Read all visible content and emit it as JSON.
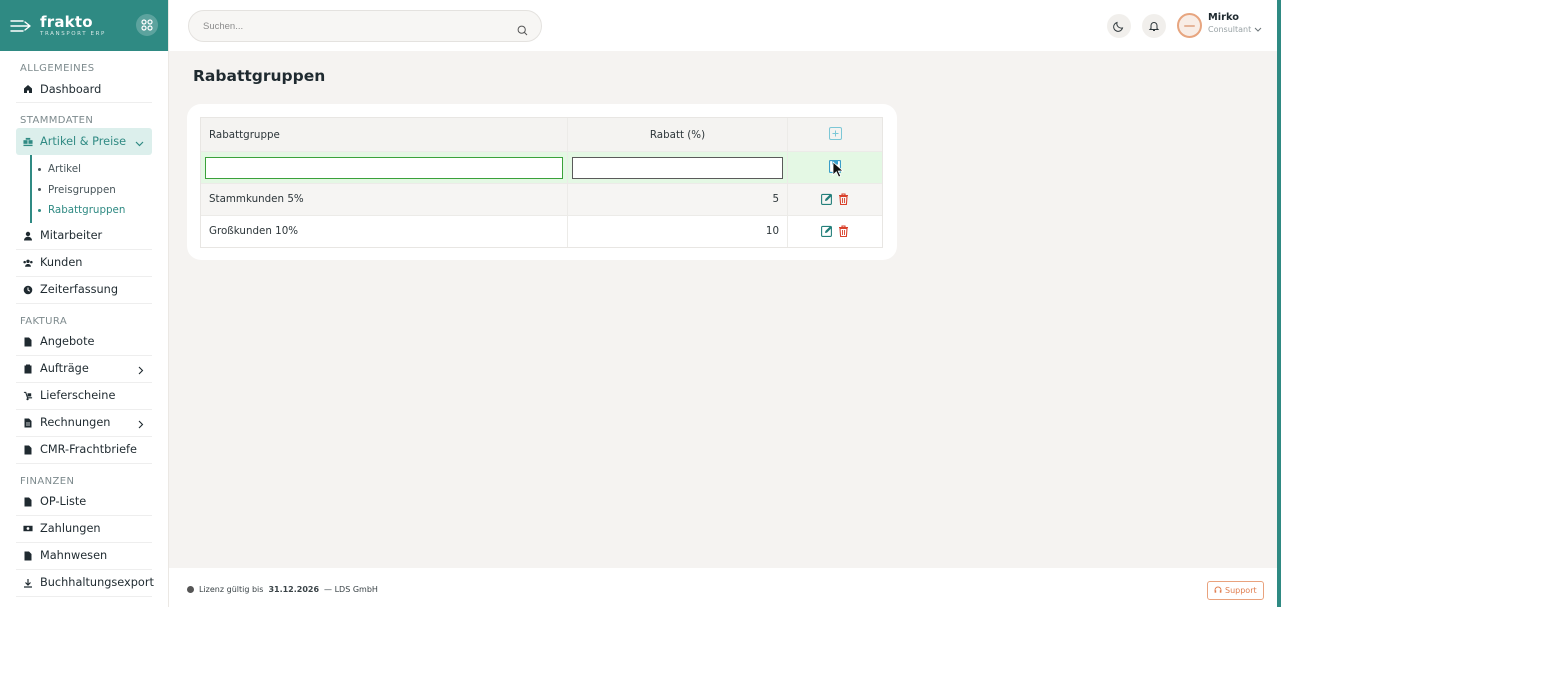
{
  "brand": {
    "name": "frakto",
    "subtitle": "TRANSPORT ERP"
  },
  "search": {
    "placeholder": "Suchen..."
  },
  "user": {
    "name": "Mirko",
    "role": "Consultant"
  },
  "sidebar": {
    "sections": [
      {
        "title": "ALLGEMEINES"
      },
      {
        "title": "STAMMDATEN"
      },
      {
        "title": "FAKTURA"
      },
      {
        "title": "FINANZEN"
      }
    ],
    "items": {
      "dashboard": "Dashboard",
      "artikel_preise": "Artikel & Preise",
      "mitarbeiter": "Mitarbeiter",
      "kunden": "Kunden",
      "zeiterfassung": "Zeiterfassung",
      "angebote": "Angebote",
      "auftraege": "Aufträge",
      "lieferscheine": "Lieferscheine",
      "rechnungen": "Rechnungen",
      "cmr": "CMR-Frachtbriefe",
      "op_liste": "OP-Liste",
      "zahlungen": "Zahlungen",
      "mahnwesen": "Mahnwesen",
      "buchhaltungsexport": "Buchhaltungsexport"
    },
    "sub_items": [
      "Artikel",
      "Preisgruppen",
      "Rabattgruppen"
    ]
  },
  "page": {
    "title": "Rabattgruppen"
  },
  "table": {
    "columns": [
      "Rabattgruppe",
      "Rabatt (%)"
    ],
    "new_row": {
      "name": "",
      "discount": ""
    },
    "rows": [
      {
        "name": "Stammkunden 5%",
        "discount": "5"
      },
      {
        "name": "Großkunden 10%",
        "discount": "10"
      }
    ]
  },
  "footer": {
    "license_prefix": "Lizenz gültig bis",
    "license_date": "31.12.2026",
    "company": "— LDS GmbH",
    "support_label": "Support"
  },
  "colors": {
    "brand": "#2f8a83",
    "danger": "#d9412b",
    "support": "#e07d4e"
  }
}
